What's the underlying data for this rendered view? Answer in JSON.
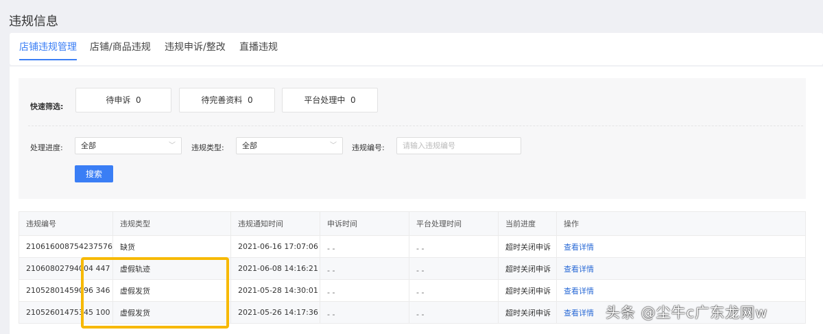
{
  "page_title": "违规信息",
  "tabs": [
    {
      "label": "店铺违规管理",
      "active": true
    },
    {
      "label": "店铺/商品违规"
    },
    {
      "label": "违规申诉/整改"
    },
    {
      "label": "直播违规"
    }
  ],
  "filter": {
    "quick_label": "快速筛选:",
    "quick": [
      {
        "label": "待申诉",
        "count": "0"
      },
      {
        "label": "待完善资料",
        "count": "0"
      },
      {
        "label": "平台处理中",
        "count": "0"
      }
    ],
    "progress_label": "处理进度:",
    "progress_value": "全部",
    "type_label": "违规类型:",
    "type_value": "全部",
    "id_label": "违规编号:",
    "id_placeholder": "请输入违规编号",
    "search_label": "搜索"
  },
  "table": {
    "headers": [
      "违规编号",
      "违规类型",
      "违规通知时间",
      "申诉时间",
      "平台处理时间",
      "当前进度",
      "操作"
    ],
    "rows": [
      {
        "id": "210616008754237576",
        "type": "缺货",
        "notice": "2021-06-16 17:07:06",
        "appeal": "- -",
        "platform": "- -",
        "status": "超时关闭申诉",
        "action": "查看详情"
      },
      {
        "id": "21060802794004 447",
        "type": "虚假轨迹",
        "notice": "2021-06-08 14:16:21",
        "appeal": "- -",
        "platform": "- -",
        "status": "超时关闭申诉",
        "action": "查看详情"
      },
      {
        "id": "21052801459096 346",
        "type": "虚假发货",
        "notice": "2021-05-28 14:30:01",
        "appeal": "- -",
        "platform": "- -",
        "status": "超时关闭申诉",
        "action": "查看详情"
      },
      {
        "id": "21052601475345 100",
        "type": "虚假发货",
        "notice": "2021-05-26 14:17:36",
        "appeal": "- -",
        "platform": "- -",
        "status": "超时关闭申诉",
        "action": "查看详情"
      }
    ]
  },
  "highlight_color": "#f7b900",
  "accent_color": "#3a7ef5",
  "watermark": "头条 @尘牛c广东龙网w"
}
